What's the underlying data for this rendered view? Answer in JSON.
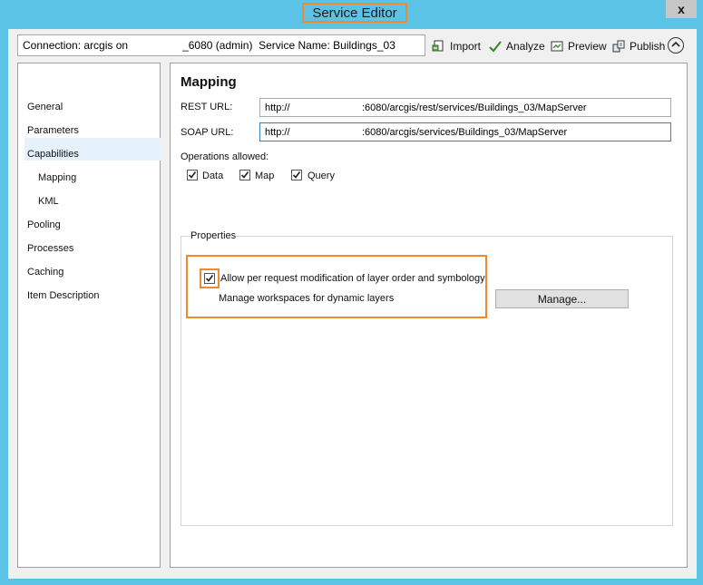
{
  "window": {
    "title": "Service Editor",
    "close_glyph": "x"
  },
  "toolbar": {
    "connection_text": "Connection: arcgis on                  _6080 (admin)  Service Name: Buildings_03",
    "buttons": [
      {
        "label": "Import",
        "icon": "import-icon"
      },
      {
        "label": "Analyze",
        "icon": "checkmark-icon"
      },
      {
        "label": "Preview",
        "icon": "preview-icon"
      },
      {
        "label": "Publish",
        "icon": "publish-icon"
      }
    ],
    "collapse_icon": "chevron-up-icon"
  },
  "nav": {
    "items": [
      "General",
      "Parameters",
      "Capabilities",
      "Mapping",
      "KML",
      "Pooling",
      "Processes",
      "Caching",
      "Item Description"
    ],
    "selected": "Mapping"
  },
  "mapping": {
    "heading": "Mapping",
    "rest_url_label": "REST URL:",
    "rest_url_value": "http://                          :6080/arcgis/rest/services/Buildings_03/MapServer",
    "soap_url_label": "SOAP URL:",
    "soap_url_value": "http://                          :6080/arcgis/services/Buildings_03/MapServer",
    "operations_label": "Operations allowed:",
    "operations": [
      {
        "label": "Data",
        "checked": true
      },
      {
        "label": "Map",
        "checked": true
      },
      {
        "label": "Query",
        "checked": true
      }
    ],
    "properties_label": "Properties",
    "allow_modification_label": "Allow per request modification of layer order and symbology",
    "allow_modification_checked": true,
    "manage_workspaces_label": "Manage workspaces for dynamic layers",
    "manage_button_label": "Manage..."
  },
  "colors": {
    "highlight": "#f08a2c",
    "window_frame": "#5bc3e6",
    "selected_row": "#e6f2fb"
  }
}
